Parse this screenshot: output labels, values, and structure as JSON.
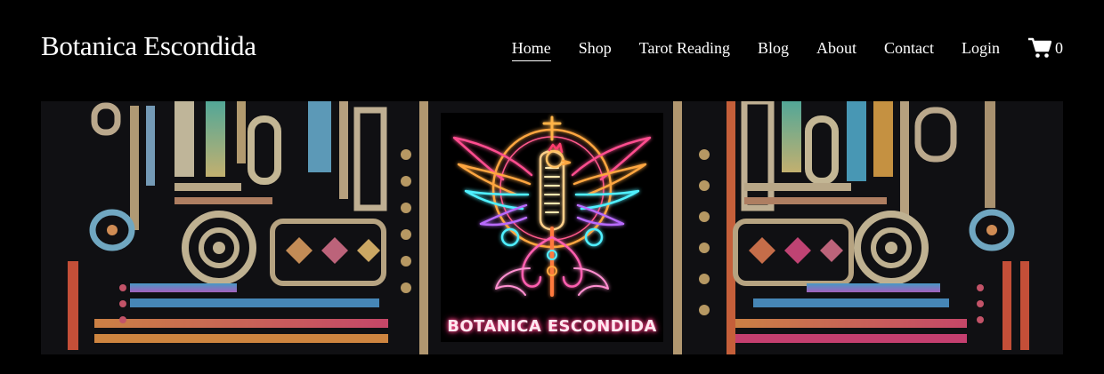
{
  "site": {
    "title": "Botanica Escondida"
  },
  "nav": {
    "items": [
      {
        "label": "Home",
        "active": true
      },
      {
        "label": "Shop"
      },
      {
        "label": "Tarot Reading"
      },
      {
        "label": "Blog"
      },
      {
        "label": "About"
      },
      {
        "label": "Contact"
      },
      {
        "label": "Login"
      }
    ]
  },
  "cart": {
    "icon": "cart-icon",
    "count": "0"
  },
  "banner": {
    "logo_text": "BOTANICA ESCONDIDA"
  },
  "colors": {
    "background": "#000000",
    "text": "#ffffff",
    "neon_pink": "#ff4d8f",
    "neon_cyan": "#4ff0ff",
    "neon_orange": "#ffa640"
  }
}
